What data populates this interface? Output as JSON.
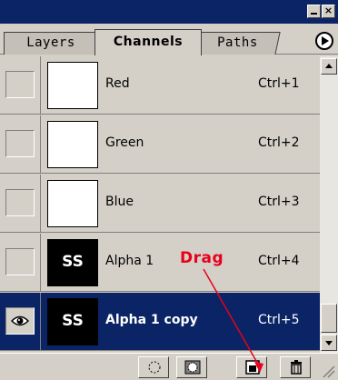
{
  "tabs": [
    {
      "label": "Layers"
    },
    {
      "label": "Channels"
    },
    {
      "label": "Paths"
    }
  ],
  "channels": [
    {
      "name": "Red",
      "shortcut": "Ctrl+1",
      "thumb_text": "",
      "visible": false,
      "selected": false
    },
    {
      "name": "Green",
      "shortcut": "Ctrl+2",
      "thumb_text": "",
      "visible": false,
      "selected": false
    },
    {
      "name": "Blue",
      "shortcut": "Ctrl+3",
      "thumb_text": "",
      "visible": false,
      "selected": false
    },
    {
      "name": "Alpha 1",
      "shortcut": "Ctrl+4",
      "thumb_text": "SS",
      "visible": false,
      "selected": false
    },
    {
      "name": "Alpha 1 copy",
      "shortcut": "Ctrl+5",
      "thumb_text": "SS",
      "visible": true,
      "selected": true
    }
  ],
  "annotation": {
    "label": "Drag",
    "color": "#e8001c"
  },
  "colors": {
    "titlebar": "#0a2466",
    "selected_row": "#0a2466",
    "panel": "#d4d0c8"
  },
  "toolbar_icons": [
    "load-selection-icon",
    "save-selection-icon",
    "new-channel-icon",
    "trash-icon"
  ]
}
